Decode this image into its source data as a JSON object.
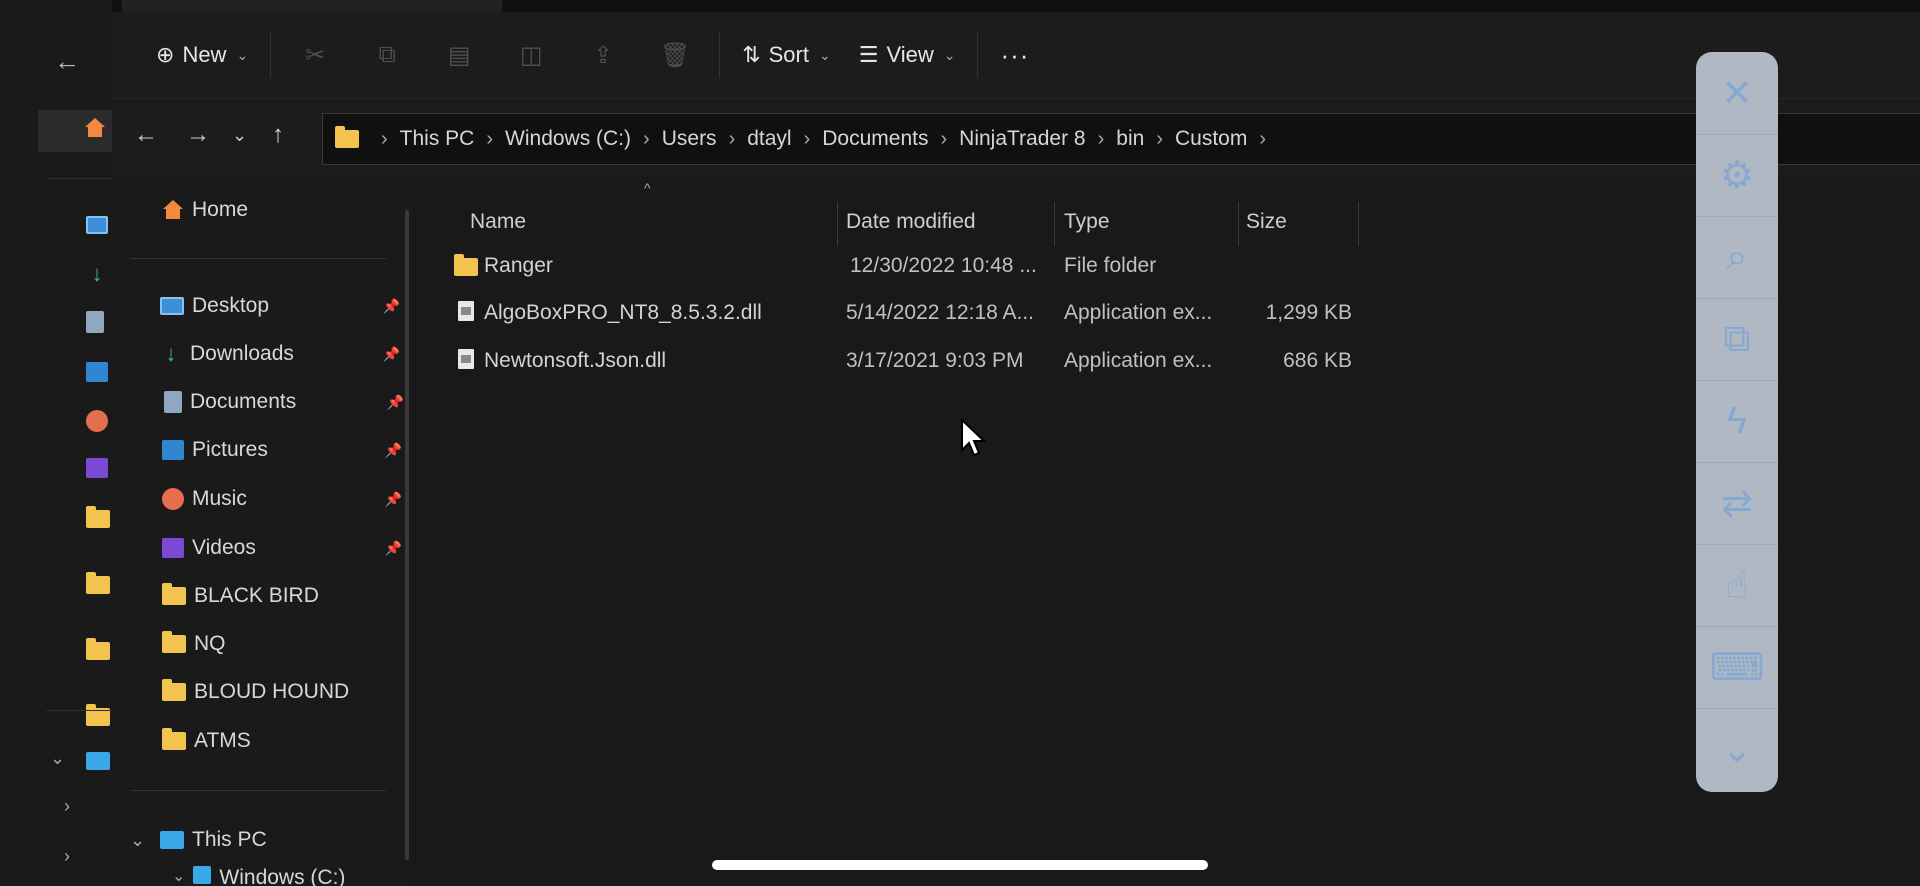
{
  "toolbar": {
    "new_label": "New",
    "sort_label": "Sort",
    "view_label": "View",
    "more_label": "···"
  },
  "address": {
    "segments": [
      "This PC",
      "Windows (C:)",
      "Users",
      "dtayl",
      "Documents",
      "NinjaTrader 8",
      "bin",
      "Custom"
    ]
  },
  "nav": {
    "home": "Home",
    "quick": [
      {
        "label": "Desktop",
        "icon": "desktop-icon",
        "pinned": true
      },
      {
        "label": "Downloads",
        "icon": "downloads-icon",
        "pinned": true
      },
      {
        "label": "Documents",
        "icon": "documents-icon",
        "pinned": true
      },
      {
        "label": "Pictures",
        "icon": "pictures-icon",
        "pinned": true
      },
      {
        "label": "Music",
        "icon": "music-icon",
        "pinned": true
      },
      {
        "label": "Videos",
        "icon": "videos-icon",
        "pinned": true
      },
      {
        "label": "BLACK BIRD",
        "icon": "folder-icon",
        "pinned": false
      },
      {
        "label": "NQ",
        "icon": "folder-icon",
        "pinned": false
      },
      {
        "label": "BLOUD HOUND",
        "icon": "folder-icon",
        "pinned": false
      },
      {
        "label": "ATMS",
        "icon": "folder-icon",
        "pinned": false
      }
    ],
    "this_pc": "This PC",
    "windows_drive": "Windows (C:)"
  },
  "columns": {
    "name": "Name",
    "date": "Date modified",
    "type": "Type",
    "size": "Size"
  },
  "files": [
    {
      "name": "Ranger",
      "date": "12/30/2022 10:48 ...",
      "type": "File folder",
      "size": "",
      "icon": "folder-icon"
    },
    {
      "name": "AlgoBoxPRO_NT8_8.5.3.2.dll",
      "date": "5/14/2022 12:18 A...",
      "type": "Application ex...",
      "size": "1,299 KB",
      "icon": "file-icon"
    },
    {
      "name": "Newtonsoft.Json.dll",
      "date": "3/17/2021 9:03 PM",
      "type": "Application ex...",
      "size": "686 KB",
      "icon": "file-icon"
    }
  ],
  "colors": {
    "background": "#191919",
    "folder": "#f2c44f",
    "float_bar": "#bcc6d2",
    "float_icon": "#8fb6e0"
  }
}
